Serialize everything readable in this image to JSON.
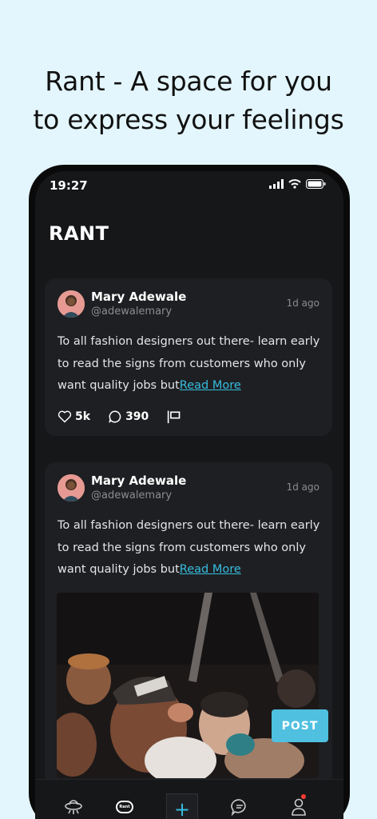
{
  "headline": {
    "line1": "Rant - A space for you",
    "line2": "to express your feelings"
  },
  "status_bar": {
    "time": "19:27"
  },
  "app": {
    "title": "RANT"
  },
  "posts": [
    {
      "name": "Mary Adewale",
      "handle": "@adewalemary",
      "time": "1d ago",
      "text": "To all fashion designers out there- learn early to read the signs from customers who only want quality jobs but",
      "read_more": "Read More",
      "likes": "5k",
      "comments": "390"
    },
    {
      "name": "Mary Adewale",
      "handle": "@adewalemary",
      "time": "1d ago",
      "text": "To all fashion designers out there- learn early to read the signs from customers who only want quality jobs but",
      "read_more": "Read More"
    }
  ],
  "fab": {
    "label": "POST"
  },
  "tabbar": {
    "rant_label": "Rant",
    "plus": "+",
    "icons": [
      "ufo-icon",
      "rant-icon",
      "plus-icon",
      "chat-icon",
      "profile-icon"
    ]
  },
  "colors": {
    "accent": "#36bde0",
    "background": "#e3f6fd",
    "card": "#1e1f22",
    "screen": "#161719"
  }
}
